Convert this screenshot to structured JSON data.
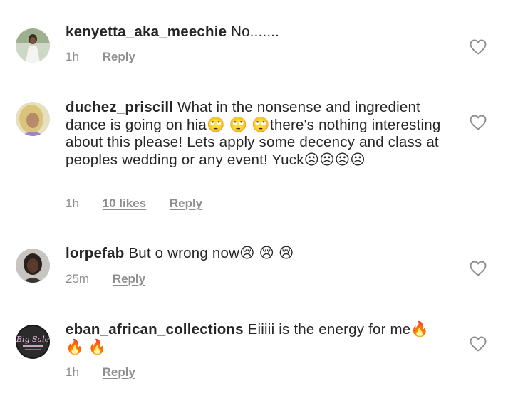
{
  "comments": [
    {
      "username": "kenyetta_aka_meechie",
      "text": "No.......",
      "time": "1h",
      "likes": "",
      "reply_label": "Reply",
      "avatar_icon": "avatar-woman-white-dress"
    },
    {
      "username": "duchez_priscill",
      "text": "What in the nonsense and ingredient dance is going on hia🙄 🙄 🙄there's nothing interesting about this please! Lets apply some decency and class at peoples wedding or any event! Yuck☹☹☹☹",
      "time": "1h",
      "likes": "10 likes",
      "reply_label": "Reply",
      "avatar_icon": "avatar-woman-blonde"
    },
    {
      "username": "lorpefab",
      "text": "But o wrong now😢 😢 😢",
      "time": "25m",
      "likes": "",
      "reply_label": "Reply",
      "avatar_icon": "avatar-woman-braids"
    },
    {
      "username": "eban_african_collections",
      "text": "Eiiiii is the energy for me🔥 🔥 🔥",
      "time": "1h",
      "likes": "",
      "reply_label": "Reply",
      "avatar_icon": "avatar-big-sale-logo",
      "avatar_logo_text": "Big Sale"
    }
  ],
  "colors": {
    "text": "#262626",
    "secondary": "#8e8e8e",
    "heart_outline": "#8e8e8e",
    "background": "#ffffff"
  }
}
